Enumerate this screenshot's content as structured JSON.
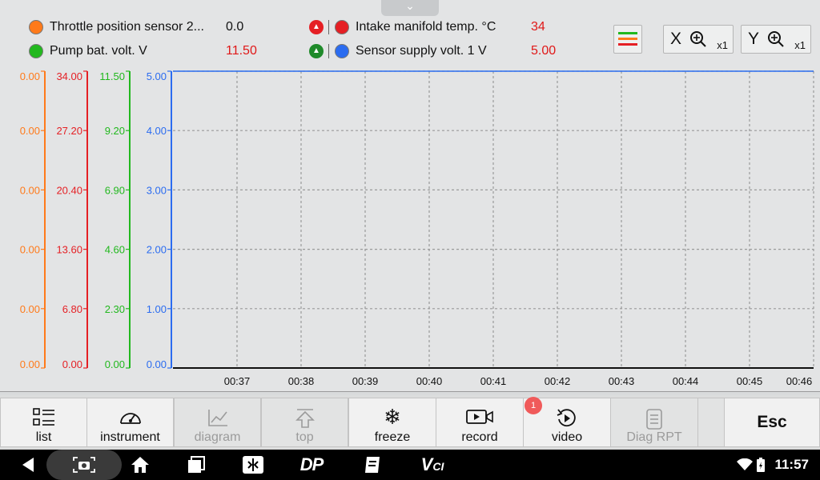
{
  "legend": [
    {
      "label": "Throttle position sensor 2...",
      "value": "0.0",
      "color": "#ff7a1a",
      "value_color": "#111111"
    },
    {
      "label": "Pump bat. volt.  V",
      "value": "11.50",
      "color": "#22b81e",
      "value_color": "#e01818"
    },
    {
      "label": "Intake manifold temp.  °C",
      "value": "34",
      "color": "#e51f24",
      "value_color": "#e01818"
    },
    {
      "label": "Sensor supply volt. 1  V",
      "value": "5.00",
      "color": "#2b6cf0",
      "value_color": "#e01818"
    }
  ],
  "zoom": {
    "x_label": "X",
    "y_label": "Y",
    "x_factor": "x1",
    "y_factor": "x1"
  },
  "chart_data": {
    "type": "line",
    "x_ticks": [
      "00:37",
      "00:38",
      "00:39",
      "00:40",
      "00:41",
      "00:42",
      "00:43",
      "00:44",
      "00:45",
      "00:46"
    ],
    "axes": [
      {
        "series": "Throttle position sensor 2",
        "color": "#ff7a1a",
        "ticks": [
          "0.00",
          "0.00",
          "0.00",
          "0.00",
          "0.00",
          "0.00"
        ],
        "ylim": [
          0,
          0
        ]
      },
      {
        "series": "Intake manifold temp.",
        "color": "#e51f24",
        "ticks": [
          "34.00",
          "27.20",
          "20.40",
          "13.60",
          "6.80",
          "0.00"
        ],
        "ylim": [
          0,
          34
        ]
      },
      {
        "series": "Pump bat. volt.",
        "color": "#22b81e",
        "ticks": [
          "11.50",
          "9.20",
          "6.90",
          "4.60",
          "2.30",
          "0.00"
        ],
        "ylim": [
          0,
          11.5
        ]
      },
      {
        "series": "Sensor supply volt. 1",
        "color": "#2b6cf0",
        "ticks": [
          "5.00",
          "4.00",
          "3.00",
          "2.00",
          "1.00",
          "0.00"
        ],
        "ylim": [
          0,
          5
        ]
      }
    ],
    "series": [
      {
        "name": "Sensor supply volt. 1",
        "color": "#2b6cf0",
        "values": [
          5.0,
          5.0,
          5.0,
          5.0,
          5.0,
          5.0,
          5.0,
          5.0,
          5.0,
          5.0
        ]
      }
    ],
    "grid": true
  },
  "toolbar": [
    {
      "id": "list",
      "label": "list",
      "icon": "list-icon",
      "disabled": false
    },
    {
      "id": "instrument",
      "label": "instrument",
      "icon": "gauge-icon",
      "disabled": false
    },
    {
      "id": "diagram",
      "label": "diagram",
      "icon": "line-chart-icon",
      "disabled": true
    },
    {
      "id": "top",
      "label": "top",
      "icon": "arrow-up-icon",
      "disabled": true
    },
    {
      "id": "freeze",
      "label": "freeze",
      "icon": "snowflake-icon",
      "disabled": false
    },
    {
      "id": "record",
      "label": "record",
      "icon": "video-camera-icon",
      "disabled": false
    },
    {
      "id": "video",
      "label": "video",
      "icon": "replay-icon",
      "disabled": false
    },
    {
      "id": "diag-rpt",
      "label": "Diag RPT",
      "icon": "document-icon",
      "disabled": true
    },
    {
      "id": "esc",
      "label": "Esc",
      "icon": "",
      "disabled": false
    }
  ],
  "video_badge": "1",
  "nav_icons": [
    "back-icon",
    "screenshot-icon",
    "home-icon",
    "recent-apps-icon",
    "dp-app-icon",
    "dp-logo-icon",
    "report-icon",
    "vci-icon"
  ],
  "status": {
    "time": "11:57",
    "icons": [
      "wifi-icon",
      "battery-charging-icon"
    ]
  }
}
